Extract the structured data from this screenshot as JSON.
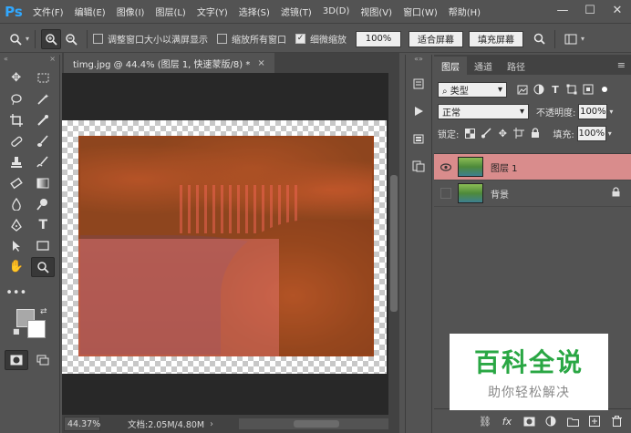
{
  "app": {
    "logo": "Ps"
  },
  "menu": [
    "文件(F)",
    "编辑(E)",
    "图像(I)",
    "图层(L)",
    "文字(Y)",
    "选择(S)",
    "滤镜(T)",
    "3D(D)",
    "视图(V)",
    "窗口(W)",
    "帮助(H)"
  ],
  "window_controls": {
    "minimize": "—",
    "maximize": "☐",
    "close": "✕"
  },
  "options": {
    "check_resize": "调整窗口大小以满屏显示",
    "check_resize_on": false,
    "check_zoom_all": "缩放所有窗口",
    "check_zoom_all_on": false,
    "check_scrubby": "细微缩放",
    "check_scrubby_on": true,
    "zoom_value": "100%",
    "fit_screen": "适合屏幕",
    "fill_screen": "填充屏幕"
  },
  "document": {
    "tab_title": "timg.jpg @ 44.4% (图层 1, 快速蒙版/8) *",
    "tab_close": "×",
    "zoom": "44.37%",
    "info": "文档:2.05M/4.80M",
    "status_arrow": "›"
  },
  "colors": {
    "quick_mask": "#d21e0a",
    "selected_layer": "#d98c8c",
    "accent": "#31a8ff",
    "watermark_green": "#2aa744"
  },
  "layers_panel": {
    "tabs": [
      "图层",
      "通道",
      "路径"
    ],
    "filter_label": "类型",
    "blend_mode": "正常",
    "opacity_label": "不透明度:",
    "opacity_value": "100%",
    "lock_label": "锁定:",
    "fill_label": "填充:",
    "fill_value": "100%",
    "layers": [
      {
        "name": "图层 1",
        "visible": true,
        "selected": true
      },
      {
        "name": "背景",
        "visible": false,
        "selected": false,
        "locked": true
      }
    ]
  },
  "watermark": {
    "title": "百科全说",
    "subtitle": "助你轻松解决"
  }
}
